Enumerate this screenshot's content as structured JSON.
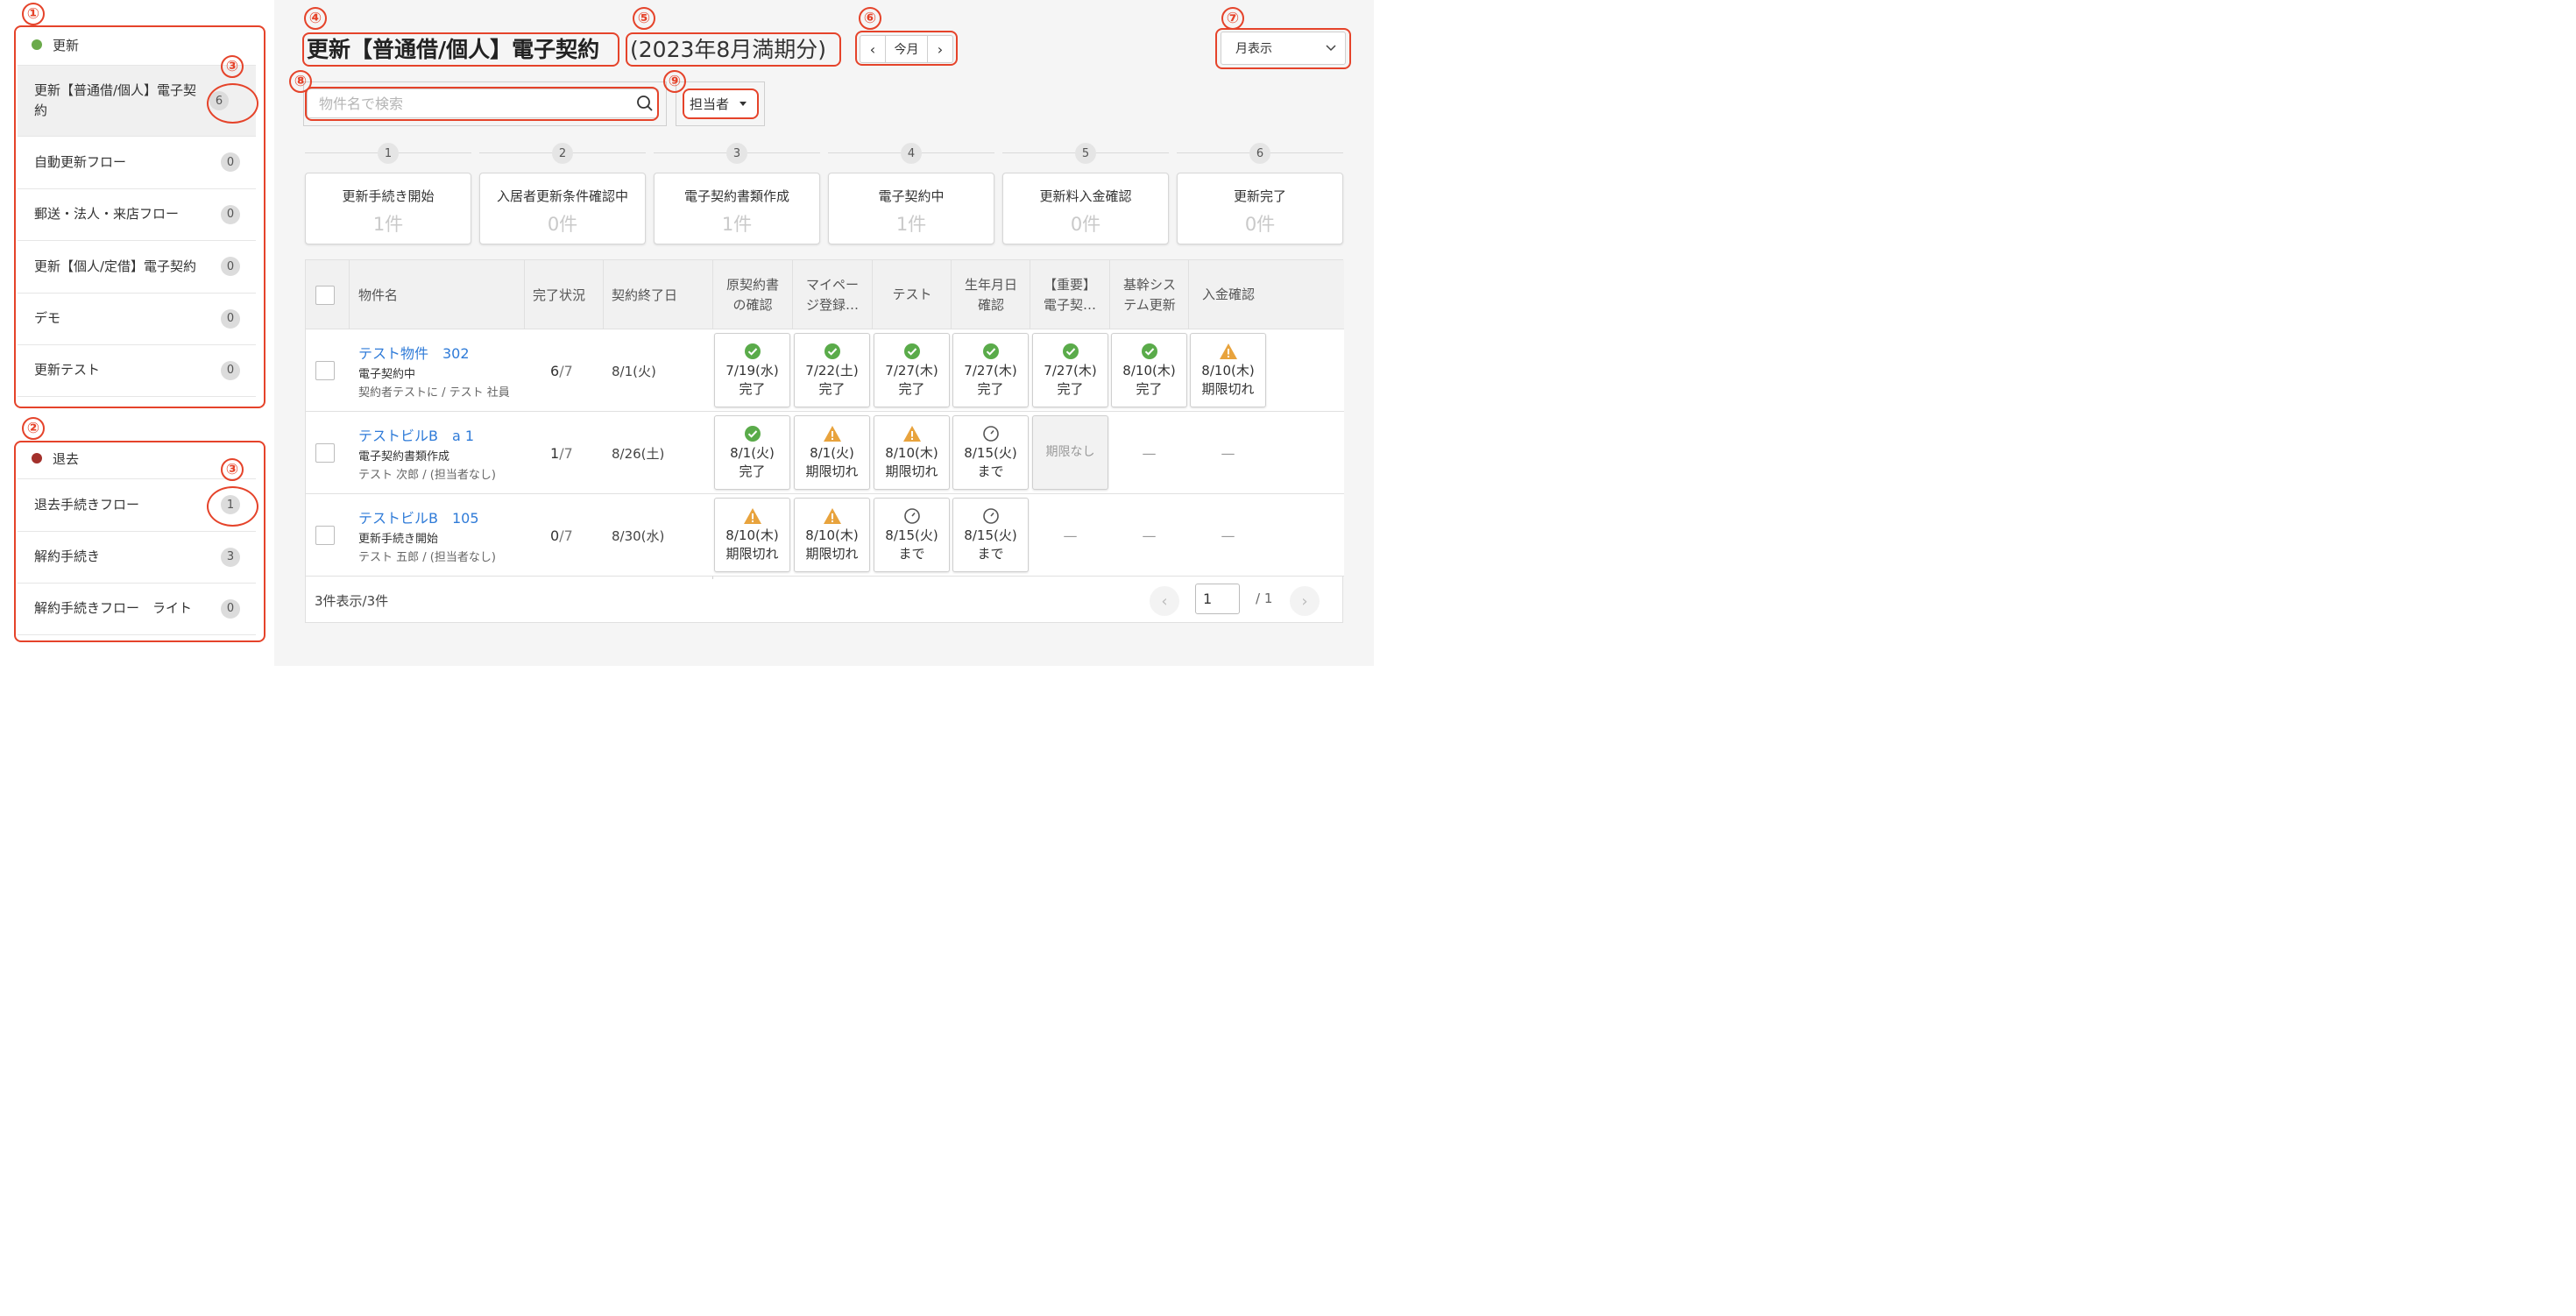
{
  "sidebar": {
    "groups": [
      {
        "name": "更新",
        "color": "#6aaa4a",
        "items": [
          {
            "label": "更新【普通借/個人】電子契約",
            "count": "6"
          },
          {
            "label": "自動更新フロー",
            "count": "0"
          },
          {
            "label": "郵送・法人・来店フロー",
            "count": "0"
          },
          {
            "label": "更新【個人/定借】電子契約",
            "count": "0"
          },
          {
            "label": "デモ",
            "count": "0"
          },
          {
            "label": "更新テスト",
            "count": "0"
          }
        ]
      },
      {
        "name": "退去",
        "color": "#a3302b",
        "items": [
          {
            "label": "退去手続きフロー",
            "count": "1"
          },
          {
            "label": "解約手続き",
            "count": "3"
          },
          {
            "label": "解約手続きフロー　ライト",
            "count": "0"
          }
        ]
      }
    ]
  },
  "annotations": {
    "n1": "①",
    "n2": "②",
    "n3": "③",
    "n4": "④",
    "n5": "⑤",
    "n6": "⑥",
    "n7": "⑦",
    "n8": "⑧",
    "n9": "⑨"
  },
  "header": {
    "title": "更新【普通借/個人】電子契約",
    "period": "(2023年8月満期分)",
    "prev": "‹",
    "current": "今月",
    "next": "›",
    "view": "月表示"
  },
  "filters": {
    "search_placeholder": "物件名で検索",
    "assignee": "担当者"
  },
  "steps": [
    {
      "num": "1",
      "title": "更新手続き開始",
      "count": "1件"
    },
    {
      "num": "2",
      "title": "入居者更新条件確認中",
      "count": "0件"
    },
    {
      "num": "3",
      "title": "電子契約書類作成",
      "count": "1件"
    },
    {
      "num": "4",
      "title": "電子契約中",
      "count": "1件"
    },
    {
      "num": "5",
      "title": "更新料入金確認",
      "count": "0件"
    },
    {
      "num": "6",
      "title": "更新完了",
      "count": "0件"
    }
  ],
  "table": {
    "headers": {
      "name": "物件名",
      "progress": "完了状況",
      "end_date": "契約終了日",
      "tasks": [
        "原契約書\nの確認",
        "マイペー\nジ登録…",
        "テスト",
        "生年月日\n確認",
        "【重要】\n電子契…",
        "基幹シス\nテム更新",
        "入金確認"
      ]
    },
    "rows": [
      {
        "name": "テスト物件　302",
        "status": "電子契約中",
        "people": "契約者テストに / テスト 社員",
        "done": "6",
        "total": "/7",
        "end_date": "8/1(火)",
        "tasks": [
          {
            "icon": "check",
            "date": "7/19(水)",
            "state": "完了"
          },
          {
            "icon": "check",
            "date": "7/22(土)",
            "state": "完了"
          },
          {
            "icon": "check",
            "date": "7/27(木)",
            "state": "完了"
          },
          {
            "icon": "check",
            "date": "7/27(木)",
            "state": "完了"
          },
          {
            "icon": "check",
            "date": "7/27(木)",
            "state": "完了"
          },
          {
            "icon": "check",
            "date": "8/10(木)",
            "state": "完了"
          },
          {
            "icon": "warning",
            "date": "8/10(木)",
            "state": "期限切れ"
          }
        ]
      },
      {
        "name": "テストビルB　a 1",
        "status": "電子契約書類作成",
        "people": "テスト 次郎 / (担当者なし)",
        "done": "1",
        "total": "/7",
        "end_date": "8/26(土)",
        "tasks": [
          {
            "icon": "check",
            "date": "8/1(火)",
            "state": "完了"
          },
          {
            "icon": "warning",
            "date": "8/1(火)",
            "state": "期限切れ"
          },
          {
            "icon": "warning",
            "date": "8/10(木)",
            "state": "期限切れ"
          },
          {
            "icon": "clock",
            "date": "8/15(火)",
            "state": "まで"
          },
          {
            "icon": "none",
            "date": "",
            "state": "期限なし"
          },
          {
            "icon": "dash",
            "date": "",
            "state": "—"
          },
          {
            "icon": "dash",
            "date": "",
            "state": "—"
          }
        ]
      },
      {
        "name": "テストビルB　105",
        "status": "更新手続き開始",
        "people": "テスト 五郎 / (担当者なし)",
        "done": "0",
        "total": "/7",
        "end_date": "8/30(水)",
        "tasks": [
          {
            "icon": "warning",
            "date": "8/10(木)",
            "state": "期限切れ"
          },
          {
            "icon": "warning",
            "date": "8/10(木)",
            "state": "期限切れ"
          },
          {
            "icon": "clock",
            "date": "8/15(火)",
            "state": "まで"
          },
          {
            "icon": "clock",
            "date": "8/15(火)",
            "state": "まで"
          },
          {
            "icon": "dash",
            "date": "",
            "state": "—"
          },
          {
            "icon": "dash",
            "date": "",
            "state": "—"
          },
          {
            "icon": "dash",
            "date": "",
            "state": "—"
          }
        ]
      }
    ],
    "footer": {
      "count_text": "3件表示/3件",
      "page": "1",
      "total_pages": "/ 1"
    }
  },
  "colors": {
    "annotation": "#e5432a",
    "link": "#2f7bd8",
    "check": "#5aab4a",
    "warning": "#e8a33d",
    "group_update": "#6aaa4a",
    "group_leave": "#a3302b"
  }
}
